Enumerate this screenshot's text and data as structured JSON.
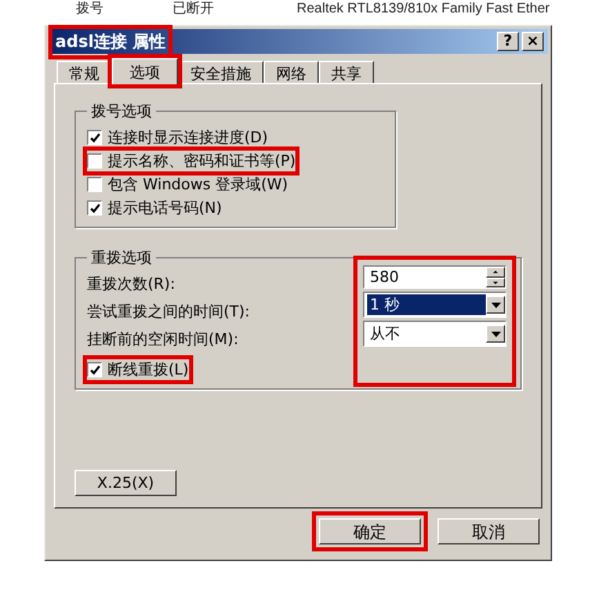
{
  "list_row": {
    "type": "拨号",
    "status": "已断开",
    "device": "Realtek RTL8139/810x Family Fast Ether"
  },
  "window": {
    "title": "adsl连接 属性",
    "highlighted": true,
    "help": "?",
    "close": "×"
  },
  "tabs": [
    {
      "label": "常规",
      "selected": false,
      "highlighted": false
    },
    {
      "label": "选项",
      "selected": true,
      "highlighted": true
    },
    {
      "label": "安全措施",
      "selected": false,
      "highlighted": false
    },
    {
      "label": "网络",
      "selected": false,
      "highlighted": false
    },
    {
      "label": "共享",
      "selected": false,
      "highlighted": false
    }
  ],
  "dial_options": {
    "title": "拨号选项",
    "items": [
      {
        "label": "连接时显示连接进度(D)",
        "checked": true,
        "highlighted": false
      },
      {
        "label": "提示名称、密码和证书等(P)",
        "checked": false,
        "highlighted": true
      },
      {
        "label": "包含 Windows 登录域(W)",
        "checked": false,
        "highlighted": false
      },
      {
        "label": "提示电话号码(N)",
        "checked": true,
        "highlighted": false
      }
    ]
  },
  "redial_options": {
    "title": "重拨选项",
    "controls_highlighted": true,
    "fields": [
      {
        "kind": "spinner",
        "label": "重拨次数(R):",
        "value": "580",
        "selected": false
      },
      {
        "kind": "dropdown",
        "label": "尝试重拨之间的时间(T):",
        "value": "1 秒",
        "selected": true
      },
      {
        "kind": "dropdown",
        "label": "挂断前的空闲时间(M):",
        "value": "从不",
        "selected": false
      }
    ],
    "redial_on_drop": {
      "label": "断线重拨(L)",
      "checked": true,
      "highlighted": true
    }
  },
  "x25_button": "X.25(X)",
  "buttons": [
    {
      "label": "确定",
      "highlighted": true
    },
    {
      "label": "取消",
      "highlighted": false
    }
  ]
}
